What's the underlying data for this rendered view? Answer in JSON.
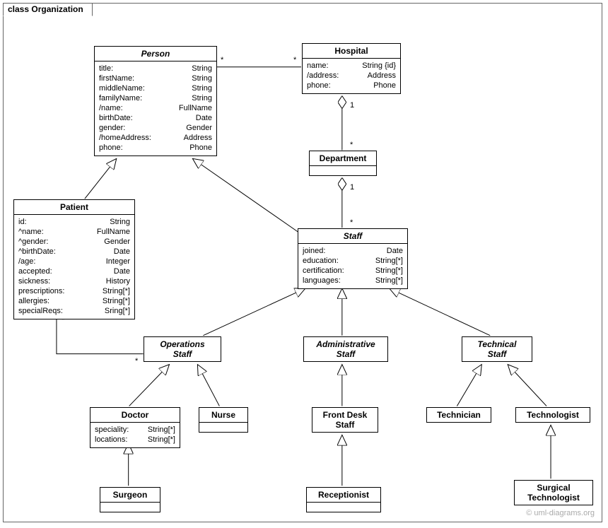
{
  "package": {
    "title": "class Organization"
  },
  "classes": {
    "person": {
      "name": "Person",
      "attrs": [
        [
          "title:",
          "String"
        ],
        [
          "firstName:",
          "String"
        ],
        [
          "middleName:",
          "String"
        ],
        [
          "familyName:",
          "String"
        ],
        [
          "/name:",
          "FullName"
        ],
        [
          "birthDate:",
          "Date"
        ],
        [
          "gender:",
          "Gender"
        ],
        [
          "/homeAddress:",
          "Address"
        ],
        [
          "phone:",
          "Phone"
        ]
      ]
    },
    "hospital": {
      "name": "Hospital",
      "attrs": [
        [
          "name:",
          "String {id}"
        ],
        [
          "/address:",
          "Address"
        ],
        [
          "phone:",
          "Phone"
        ]
      ]
    },
    "department": {
      "name": "Department"
    },
    "patient": {
      "name": "Patient",
      "attrs": [
        [
          "id:",
          "String"
        ],
        [
          "^name:",
          "FullName"
        ],
        [
          "^gender:",
          "Gender"
        ],
        [
          "^birthDate:",
          "Date"
        ],
        [
          "/age:",
          "Integer"
        ],
        [
          "accepted:",
          "Date"
        ],
        [
          "sickness:",
          "History"
        ],
        [
          "prescriptions:",
          "String[*]"
        ],
        [
          "allergies:",
          "String[*]"
        ],
        [
          "specialReqs:",
          "Sring[*]"
        ]
      ]
    },
    "staff": {
      "name": "Staff",
      "attrs": [
        [
          "joined:",
          "Date"
        ],
        [
          "education:",
          "String[*]"
        ],
        [
          "certification:",
          "String[*]"
        ],
        [
          "languages:",
          "String[*]"
        ]
      ]
    },
    "operationsStaff": {
      "name1": "Operations",
      "name2": "Staff"
    },
    "administrativeStaff": {
      "name1": "Administrative",
      "name2": "Staff"
    },
    "technicalStaff": {
      "name1": "Technical",
      "name2": "Staff"
    },
    "doctor": {
      "name": "Doctor",
      "attrs": [
        [
          "speciality:",
          "String[*]"
        ],
        [
          "locations:",
          "String[*]"
        ]
      ]
    },
    "nurse": {
      "name": "Nurse"
    },
    "frontDeskStaff": {
      "name1": "Front Desk",
      "name2": "Staff"
    },
    "technician": {
      "name": "Technician"
    },
    "technologist": {
      "name": "Technologist"
    },
    "surgeon": {
      "name": "Surgeon"
    },
    "receptionist": {
      "name": "Receptionist"
    },
    "surgicalTechnologist": {
      "name1": "Surgical",
      "name2": "Technologist"
    }
  },
  "mult": {
    "personHospital_person": "*",
    "personHospital_hospital": "*",
    "hospitalDept_hospital": "1",
    "hospitalDept_dept": "*",
    "deptStaff_dept": "1",
    "deptStaff_staff": "*",
    "patientOps_patient": "*",
    "patientOps_ops": "*"
  },
  "watermark": "© uml-diagrams.org"
}
